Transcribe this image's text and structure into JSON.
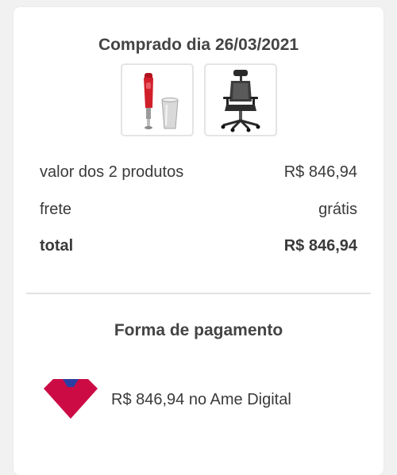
{
  "order": {
    "title": "Comprado dia 26/03/2021",
    "products": [
      {
        "icon": "hand-blender-icon",
        "accent": "#d11f2a"
      },
      {
        "icon": "office-chair-icon",
        "accent": "#2a2a2a"
      }
    ]
  },
  "summary": {
    "items_label": "valor dos 2 produtos",
    "items_value": "R$ 846,94",
    "shipping_label": "frete",
    "shipping_value": "grátis",
    "total_label": "total",
    "total_value": "R$ 846,94"
  },
  "payment": {
    "title": "Forma de pagamento",
    "method_text": "R$ 846,94 no Ame Digital",
    "logo_icon": "ame-digital-logo-icon",
    "logo_colors": {
      "primary": "#cc0b45",
      "secondary": "#2b3fa3"
    }
  }
}
